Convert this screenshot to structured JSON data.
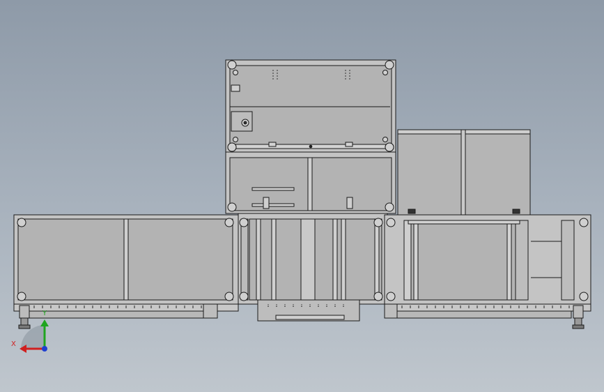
{
  "viewport": {
    "background_top": "#8e9aa8",
    "background_bottom": "#bfc6cd",
    "panel_fill": "#b3b3b3",
    "frame_fill": "#c4c4c4",
    "line_color": "#1a1a1a"
  },
  "triad": {
    "x_label": "X",
    "y_label": "Y",
    "x_color": "#d01f1f",
    "y_color": "#1fa51f",
    "z_color": "#1f3fd0",
    "icon": "coordinate-triad-icon"
  }
}
